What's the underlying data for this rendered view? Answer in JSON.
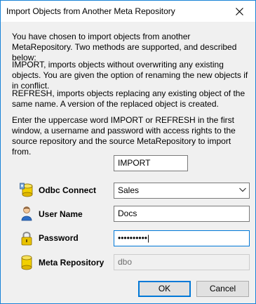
{
  "window": {
    "title": "Import Objects from Another Meta Repository"
  },
  "intro": {
    "p1": "You have chosen to import objects from another MetaRepository. Two methods are supported, and described below:",
    "p2": "IMPORT, imports objects without overwriting any existing objects. You are given the option of renaming the new objects if in conflict.",
    "p3": "REFRESH, imports objects replacing any existing object of the same name. A version of the replaced object is created.",
    "p4": "Enter the uppercase word IMPORT or REFRESH in the first window, a username and password with access rights to the source repository and the source MetaRepository to import from."
  },
  "form": {
    "mode_value": "IMPORT",
    "odbc_label": "Odbc Connect",
    "odbc_value": "Sales",
    "user_label": "User Name",
    "user_value": "Docs",
    "password_label": "Password",
    "password_value": "••••••••••|",
    "repo_label": "Meta Repository",
    "repo_value": "dbo"
  },
  "buttons": {
    "ok": "OK",
    "cancel": "Cancel"
  },
  "icons": {
    "close": "close-icon",
    "odbc": "database-connect-icon",
    "user": "user-icon",
    "password": "padlock-icon",
    "repo": "database-icon",
    "dropdown": "chevron-down-icon"
  },
  "colors": {
    "accent": "#0078d7",
    "window_border": "#1883d7"
  }
}
